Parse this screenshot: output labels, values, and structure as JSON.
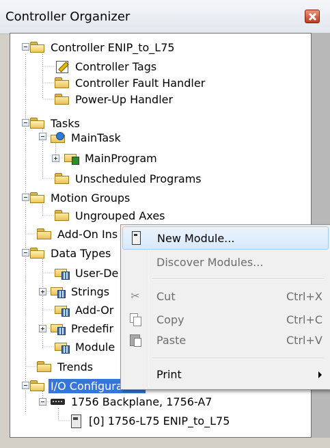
{
  "window": {
    "title": "Controller Organizer"
  },
  "tree": {
    "controller": "Controller ENIP_to_L75",
    "controller_tags": "Controller Tags",
    "fault_handler": "Controller Fault Handler",
    "powerup_handler": "Power-Up Handler",
    "tasks": "Tasks",
    "main_task": "MainTask",
    "main_program": "MainProgram",
    "unscheduled": "Unscheduled Programs",
    "motion_groups": "Motion Groups",
    "ungrouped_axes": "Ungrouped Axes",
    "addon_instructions": "Add-On Ins",
    "data_types": "Data Types",
    "user_defined": "User-De",
    "strings": "Strings",
    "addon_defined": "Add-Or",
    "predefined": "Predefir",
    "module_defined": "Module",
    "trends": "Trends",
    "io_config": "I/O Configuration",
    "backplane": "1756 Backplane, 1756-A7",
    "module_slot0": "[0] 1756-L75 ENIP_to_L75"
  },
  "context_menu": {
    "new_module": "New Module...",
    "discover_modules": "Discover Modules...",
    "cut": "Cut",
    "cut_shortcut": "Ctrl+X",
    "copy": "Copy",
    "copy_shortcut": "Ctrl+C",
    "paste": "Paste",
    "paste_shortcut": "Ctrl+V",
    "print": "Print"
  },
  "colors": {
    "selection": "#3875d7",
    "menu_highlight": "#d9e9fb"
  }
}
